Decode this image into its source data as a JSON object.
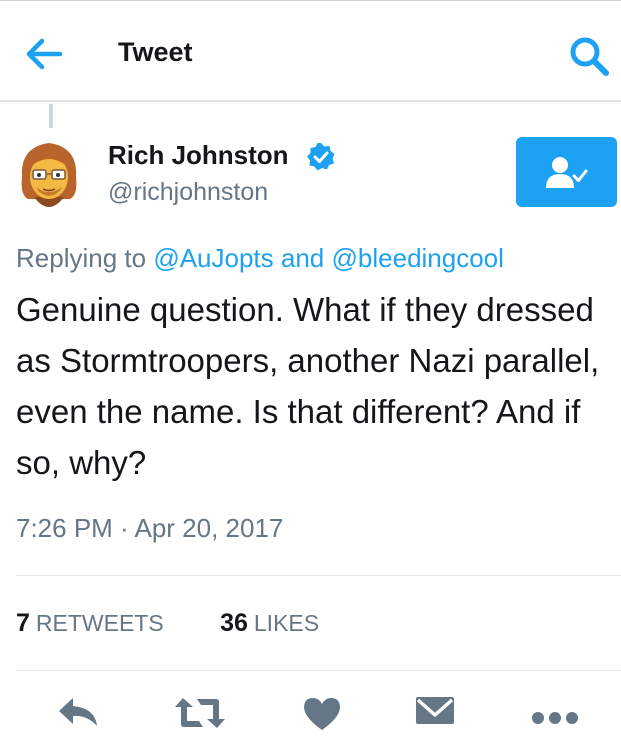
{
  "header": {
    "title": "Tweet",
    "back_icon": "arrow-left-icon",
    "search_icon": "search-icon"
  },
  "tweet": {
    "author": {
      "name": "Rich Johnston",
      "handle": "@richjohnston",
      "verified": true
    },
    "replying_to": {
      "prefix": "Replying to",
      "mention_1": "@AuJopts",
      "connector": "and",
      "mention_2": "@bleedingcool"
    },
    "text": "Genuine question. What if they dressed as Stormtroopers, another Nazi parallel, even the name. Is that different? And if so, why?",
    "timestamp": "7:26 PM · Apr 20, 2017",
    "stats": {
      "retweets_count": "7",
      "retweets_label": "RETWEETS",
      "likes_count": "36",
      "likes_label": "LIKES"
    }
  },
  "actions": [
    "reply-icon",
    "retweet-icon",
    "like-icon",
    "dm-icon",
    "more-icon"
  ],
  "colors": {
    "accent": "#1da1f2",
    "text_primary": "#14171a",
    "text_secondary": "#657786",
    "action_gray": "#657786"
  }
}
